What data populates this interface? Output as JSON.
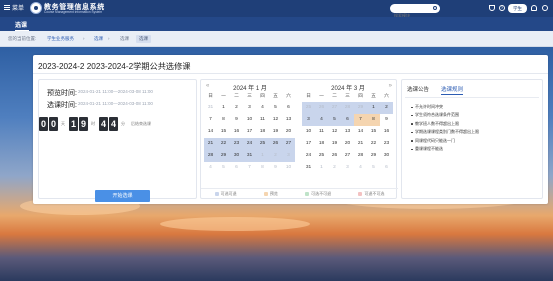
{
  "topbar": {
    "menu_label": "菜单",
    "system_title": "教务管理信息系统",
    "system_subtitle": "Course Management Information System",
    "search_placeholder": "搜索模块",
    "term_label": "学生"
  },
  "subbar": {
    "page_label": "选课"
  },
  "breadcrumb": {
    "location": "您的当前位置:",
    "module": "学生业务服务",
    "page": "选课",
    "sub": "选课",
    "tag": "选课"
  },
  "panel": {
    "title": "2023-2024-2 2023-2024-2学期公共选修课",
    "precheck_label": "预览时间:",
    "precheck_value": "2024-01-21 11:00—2024-03-08 11:00",
    "select_label": "选课时间:",
    "select_value": "2024-01-21 11:00—2024-03-08 11:00",
    "countdown": {
      "days": "00",
      "hours": "19",
      "minutes": "44"
    },
    "countdown_units": {
      "days": "天",
      "hours": "时",
      "minutes": "分"
    },
    "countdown_suffix": "后结束选课",
    "start_button": "开始选课"
  },
  "calendar": {
    "weekdays": [
      "日",
      "一",
      "二",
      "三",
      "四",
      "五",
      "六"
    ],
    "months": [
      {
        "title": "2024 年 1 月",
        "days": [
          {
            "d": "31",
            "s": "muted"
          },
          {
            "d": "1",
            "s": ""
          },
          {
            "d": "2",
            "s": ""
          },
          {
            "d": "3",
            "s": ""
          },
          {
            "d": "4",
            "s": ""
          },
          {
            "d": "5",
            "s": ""
          },
          {
            "d": "6",
            "s": ""
          },
          {
            "d": "7",
            "s": ""
          },
          {
            "d": "8",
            "s": ""
          },
          {
            "d": "9",
            "s": ""
          },
          {
            "d": "10",
            "s": ""
          },
          {
            "d": "11",
            "s": ""
          },
          {
            "d": "12",
            "s": ""
          },
          {
            "d": "13",
            "s": ""
          },
          {
            "d": "14",
            "s": ""
          },
          {
            "d": "15",
            "s": ""
          },
          {
            "d": "16",
            "s": ""
          },
          {
            "d": "17",
            "s": ""
          },
          {
            "d": "18",
            "s": ""
          },
          {
            "d": "19",
            "s": ""
          },
          {
            "d": "20",
            "s": ""
          },
          {
            "d": "21",
            "s": "sel"
          },
          {
            "d": "22",
            "s": "sel"
          },
          {
            "d": "23",
            "s": "sel"
          },
          {
            "d": "24",
            "s": "sel"
          },
          {
            "d": "25",
            "s": "sel"
          },
          {
            "d": "26",
            "s": "sel"
          },
          {
            "d": "27",
            "s": "sel"
          },
          {
            "d": "28",
            "s": "sel"
          },
          {
            "d": "29",
            "s": "sel"
          },
          {
            "d": "30",
            "s": "sel"
          },
          {
            "d": "31",
            "s": "sel"
          },
          {
            "d": "1",
            "s": "muted sel"
          },
          {
            "d": "2",
            "s": "muted sel"
          },
          {
            "d": "3",
            "s": "muted sel"
          },
          {
            "d": "4",
            "s": "muted"
          },
          {
            "d": "5",
            "s": "muted"
          },
          {
            "d": "6",
            "s": "muted"
          },
          {
            "d": "7",
            "s": "muted"
          },
          {
            "d": "8",
            "s": "muted"
          },
          {
            "d": "9",
            "s": "muted"
          },
          {
            "d": "10",
            "s": "muted"
          }
        ]
      },
      {
        "title": "2024 年 3 月",
        "days": [
          {
            "d": "25",
            "s": "muted sel"
          },
          {
            "d": "26",
            "s": "muted sel"
          },
          {
            "d": "27",
            "s": "muted sel"
          },
          {
            "d": "28",
            "s": "muted sel"
          },
          {
            "d": "29",
            "s": "muted sel"
          },
          {
            "d": "1",
            "s": "sel"
          },
          {
            "d": "2",
            "s": "sel"
          },
          {
            "d": "3",
            "s": "sel"
          },
          {
            "d": "4",
            "s": "sel"
          },
          {
            "d": "5",
            "s": "sel"
          },
          {
            "d": "6",
            "s": "sel"
          },
          {
            "d": "7",
            "s": "hl"
          },
          {
            "d": "8",
            "s": "hl"
          },
          {
            "d": "9",
            "s": ""
          },
          {
            "d": "10",
            "s": ""
          },
          {
            "d": "11",
            "s": ""
          },
          {
            "d": "12",
            "s": ""
          },
          {
            "d": "13",
            "s": ""
          },
          {
            "d": "14",
            "s": ""
          },
          {
            "d": "15",
            "s": ""
          },
          {
            "d": "16",
            "s": ""
          },
          {
            "d": "17",
            "s": ""
          },
          {
            "d": "18",
            "s": ""
          },
          {
            "d": "19",
            "s": ""
          },
          {
            "d": "20",
            "s": ""
          },
          {
            "d": "21",
            "s": ""
          },
          {
            "d": "22",
            "s": ""
          },
          {
            "d": "23",
            "s": ""
          },
          {
            "d": "24",
            "s": ""
          },
          {
            "d": "25",
            "s": ""
          },
          {
            "d": "26",
            "s": ""
          },
          {
            "d": "27",
            "s": ""
          },
          {
            "d": "28",
            "s": ""
          },
          {
            "d": "29",
            "s": ""
          },
          {
            "d": "30",
            "s": ""
          },
          {
            "d": "31",
            "s": ""
          },
          {
            "d": "1",
            "s": "muted"
          },
          {
            "d": "2",
            "s": "muted"
          },
          {
            "d": "3",
            "s": "muted"
          },
          {
            "d": "4",
            "s": "muted"
          },
          {
            "d": "5",
            "s": "muted"
          },
          {
            "d": "6",
            "s": "muted"
          }
        ]
      }
    ],
    "legend": [
      {
        "label": "可选可退",
        "color": "#c9d5ec"
      },
      {
        "label": "预览",
        "color": "#f5d5b0"
      },
      {
        "label": "可选不可退",
        "color": "#bfe3c9"
      },
      {
        "label": "可退不可选",
        "color": "#f3c2c2"
      }
    ]
  },
  "right_panel": {
    "tabs": [
      "选课公告",
      "选课规则"
    ],
    "rules": [
      "不允许时间冲突",
      "学生须符合选课条件范围",
      "教学班人数不得超出上限",
      "学期选课课程类别门数不得超出上限",
      "同课程代码只能选一门",
      "重课课程不能选"
    ]
  }
}
